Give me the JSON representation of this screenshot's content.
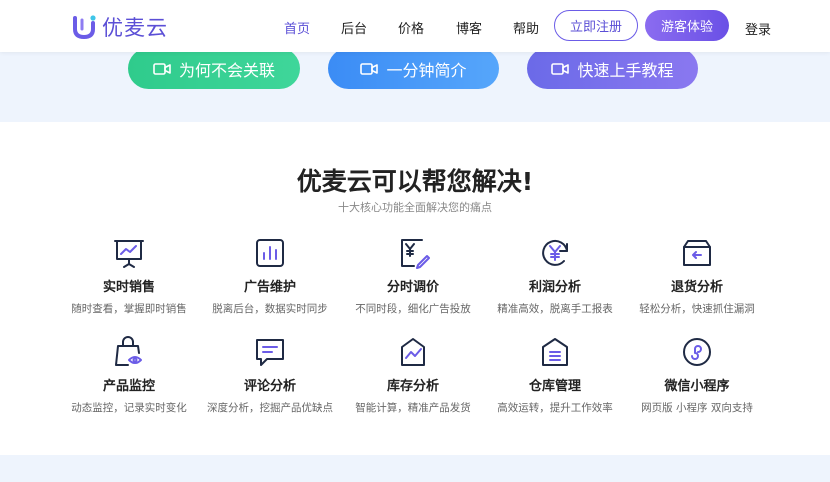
{
  "header": {
    "logo_text": "优麦云",
    "nav": [
      "首页",
      "后台",
      "价格",
      "博客",
      "帮助"
    ],
    "register_label": "立即注册",
    "guest_label": "游客体验",
    "login_label": "登录"
  },
  "hero": {
    "buttons": [
      "为何不会关联",
      "一分钟简介",
      "快速上手教程"
    ]
  },
  "section": {
    "title": "优麦云可以帮您解决!",
    "subtitle": "十大核心功能全面解决您的痛点"
  },
  "features": [
    {
      "title": "实时销售",
      "desc": "随时查看，掌握即时销售",
      "icon": "sales-chart-icon"
    },
    {
      "title": "广告维护",
      "desc": "脱离后台，数据实时同步",
      "icon": "bar-chart-icon"
    },
    {
      "title": "分时调价",
      "desc": "不同时段，细化广告投放",
      "icon": "price-edit-icon"
    },
    {
      "title": "利润分析",
      "desc": "精准高效，脱离手工报表",
      "icon": "yen-cycle-icon"
    },
    {
      "title": "退货分析",
      "desc": "轻松分析，快速抓住漏洞",
      "icon": "return-box-icon"
    },
    {
      "title": "产品监控",
      "desc": "动态监控，记录实时变化",
      "icon": "bag-eye-icon"
    },
    {
      "title": "评论分析",
      "desc": "深度分析，挖掘产品优缺点",
      "icon": "comment-icon"
    },
    {
      "title": "库存分析",
      "desc": "智能计算，精准产品发货",
      "icon": "stock-icon"
    },
    {
      "title": "仓库管理",
      "desc": "高效运转，提升工作效率",
      "icon": "warehouse-icon"
    },
    {
      "title": "微信小程序",
      "desc": "网页版 小程序 双向支持",
      "icon": "mini-program-icon"
    }
  ],
  "colors": {
    "accent": "#5b4fd6",
    "green": "#2fcb8c",
    "blue": "#3b8cf5",
    "purple": "#6b6ae8"
  }
}
